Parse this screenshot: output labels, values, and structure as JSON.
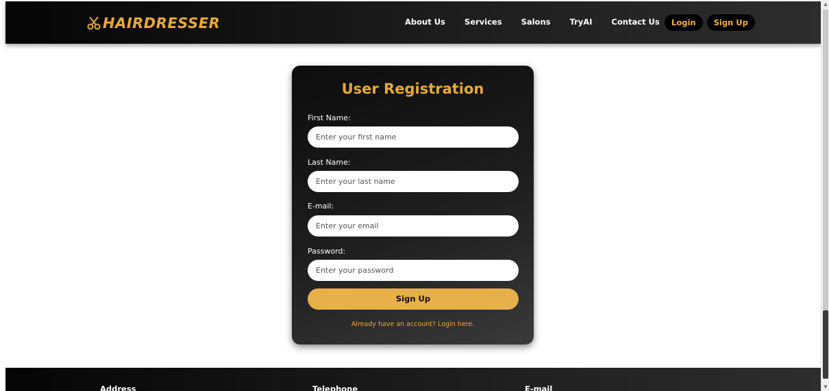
{
  "header": {
    "logo_text": "HAIRDRESSER",
    "logo_icon": "scissors-icon",
    "nav": [
      "About Us",
      "Services",
      "Salons",
      "TryAI",
      "Contact Us"
    ],
    "login_label": "Login",
    "signup_label": "Sign Up"
  },
  "form": {
    "title": "User Registration",
    "fields": [
      {
        "label": "First Name:",
        "placeholder": "Enter your first name"
      },
      {
        "label": "Last Name:",
        "placeholder": "Enter your last name"
      },
      {
        "label": "E-mail:",
        "placeholder": "Enter your email"
      },
      {
        "label": "Password:",
        "placeholder": "Enter your password"
      }
    ],
    "submit_label": "Sign Up",
    "login_link": "Already have an account? Login here."
  },
  "footer": {
    "headings": [
      "Address",
      "Telephone",
      "E-mail"
    ]
  },
  "colors": {
    "accent": "#e8a93a",
    "button": "#e8b04a",
    "dark": "#000000"
  }
}
